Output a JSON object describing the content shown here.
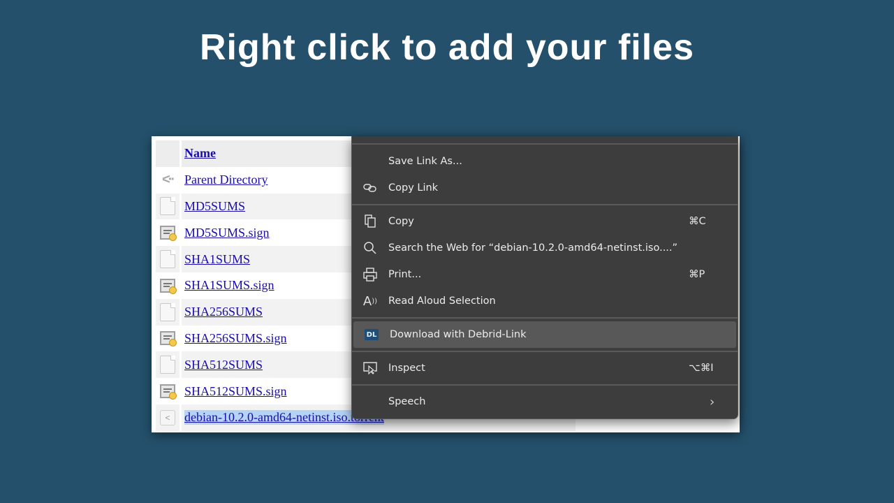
{
  "headline": "Right click to add your files",
  "listing": {
    "header": "Name",
    "rows": [
      {
        "name": "Parent Directory",
        "icon": "back-icon"
      },
      {
        "name": "MD5SUMS",
        "icon": "text-file-icon"
      },
      {
        "name": "MD5SUMS.sign",
        "icon": "signature-file-icon"
      },
      {
        "name": "SHA1SUMS",
        "icon": "text-file-icon"
      },
      {
        "name": "SHA1SUMS.sign",
        "icon": "signature-file-icon"
      },
      {
        "name": "SHA256SUMS",
        "icon": "text-file-icon"
      },
      {
        "name": "SHA256SUMS.sign",
        "icon": "signature-file-icon"
      },
      {
        "name": "SHA512SUMS",
        "icon": "text-file-icon"
      },
      {
        "name": "SHA512SUMS.sign",
        "icon": "signature-file-icon"
      },
      {
        "name": "debian-10.2.0-amd64-netinst.iso.torrent",
        "icon": "torrent-file-icon",
        "selected": true
      }
    ]
  },
  "context_menu": {
    "items": [
      {
        "label": "Save Link As...",
        "icon": "",
        "shortcut": ""
      },
      {
        "label": "Copy Link",
        "icon": "link-icon",
        "shortcut": ""
      },
      {
        "label": "Copy",
        "icon": "copy-icon",
        "shortcut": "⌘C"
      },
      {
        "label": "Search the Web for “debian-10.2.0-amd64-netinst.iso....”",
        "icon": "search-icon",
        "shortcut": ""
      },
      {
        "label": "Print...",
        "icon": "printer-icon",
        "shortcut": "⌘P"
      },
      {
        "label": "Read Aloud Selection",
        "icon": "read-aloud-icon",
        "shortcut": ""
      },
      {
        "label": "Download with Debrid-Link",
        "icon": "debrid-link-icon",
        "icon_text": "DL",
        "shortcut": "",
        "highlighted": true
      },
      {
        "label": "Inspect",
        "icon": "inspect-icon",
        "shortcut": "⌥⌘I"
      },
      {
        "label": "Speech",
        "icon": "",
        "shortcut": "",
        "submenu": true
      }
    ]
  },
  "colors": {
    "background": "#24506b",
    "menu_bg": "#3d3d3d",
    "menu_highlight": "#585858",
    "link": "#1a0dab",
    "debrid_brand": "#1f4f78"
  }
}
